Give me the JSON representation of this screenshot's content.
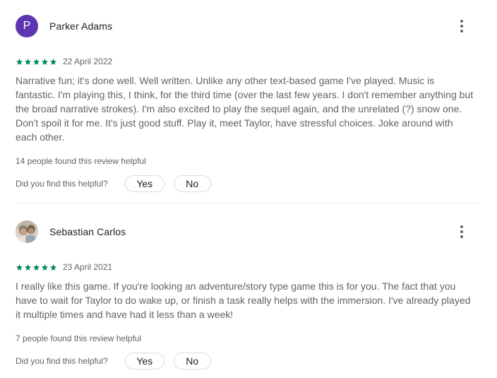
{
  "colors": {
    "star": "#01875f",
    "avatar_letter_bg": "#5e35b1",
    "text_primary": "#202124",
    "text_secondary": "#5f6368",
    "divider": "#e8eaed"
  },
  "reviews": [
    {
      "author": "Parker Adams",
      "avatar_letter": "P",
      "rating": 5,
      "date": "22 April 2022",
      "text": "Narrative fun; it's done well. Well written. Unlike any other text-based game I've played. Music is fantastic. I'm playing this, I think, for the third time (over the last few years. I don't remember anything but the broad narrative strokes). I'm also excited to play the sequel again, and the unrelated (?) snow one. Don't spoil it for me. It's just good stuff. Play it, meet Taylor, have stressful choices. Joke around with each other.",
      "helpful_count_text": "14 people found this review helpful",
      "helpful_question": "Did you find this helpful?",
      "yes_label": "Yes",
      "no_label": "No"
    },
    {
      "author": "Sebastian Carlos",
      "rating": 5,
      "date": "23 April 2021",
      "text": "I really like this game. If you're looking an adventure/story type game this is for you. The fact that you have to wait for Taylor to do wake up, or finish a task really helps with the immersion. I've already played it multiple times and have had it less than a week!",
      "helpful_count_text": "7 people found this review helpful",
      "helpful_question": "Did you find this helpful?",
      "yes_label": "Yes",
      "no_label": "No"
    }
  ]
}
